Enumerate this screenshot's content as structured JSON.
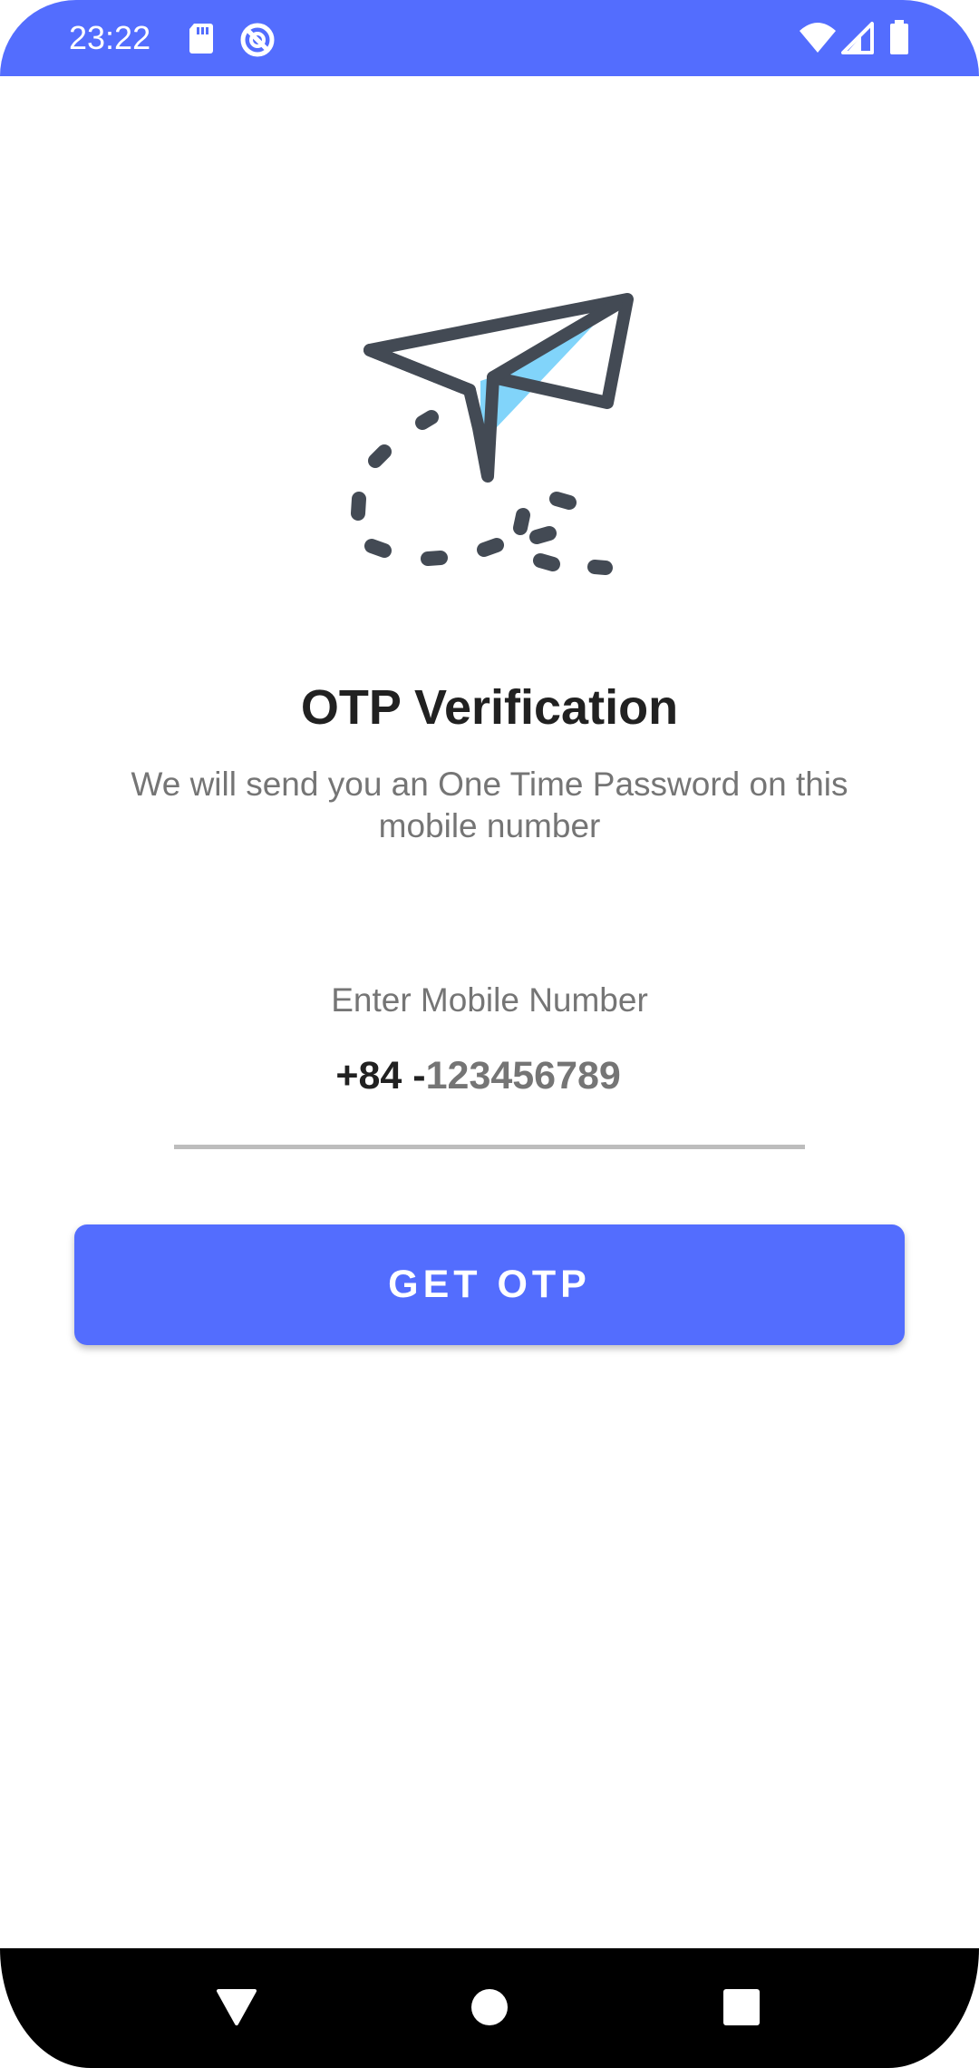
{
  "status_bar": {
    "time": "23:22",
    "icons": [
      "sd-card-icon",
      "sync-disabled-icon",
      "wifi-icon",
      "cellular-signal-icon",
      "battery-icon"
    ],
    "background_color": "#536dfe"
  },
  "illustration": {
    "icon": "paper-plane-icon",
    "colors": {
      "stroke": "#434a54",
      "accent": "#81d4fa"
    }
  },
  "main": {
    "title": "OTP Verification",
    "subtitle": "We will send you an One Time Password on this mobile number",
    "field_label": "Enter Mobile Number",
    "country_code": "+84 -",
    "phone_placeholder": "123456789",
    "phone_value": ""
  },
  "action": {
    "button_label": "GET OTP",
    "button_color": "#536dfe"
  },
  "nav_bar": {
    "back_icon": "back-triangle-icon",
    "home_icon": "home-circle-icon",
    "recents_icon": "recents-square-icon"
  }
}
